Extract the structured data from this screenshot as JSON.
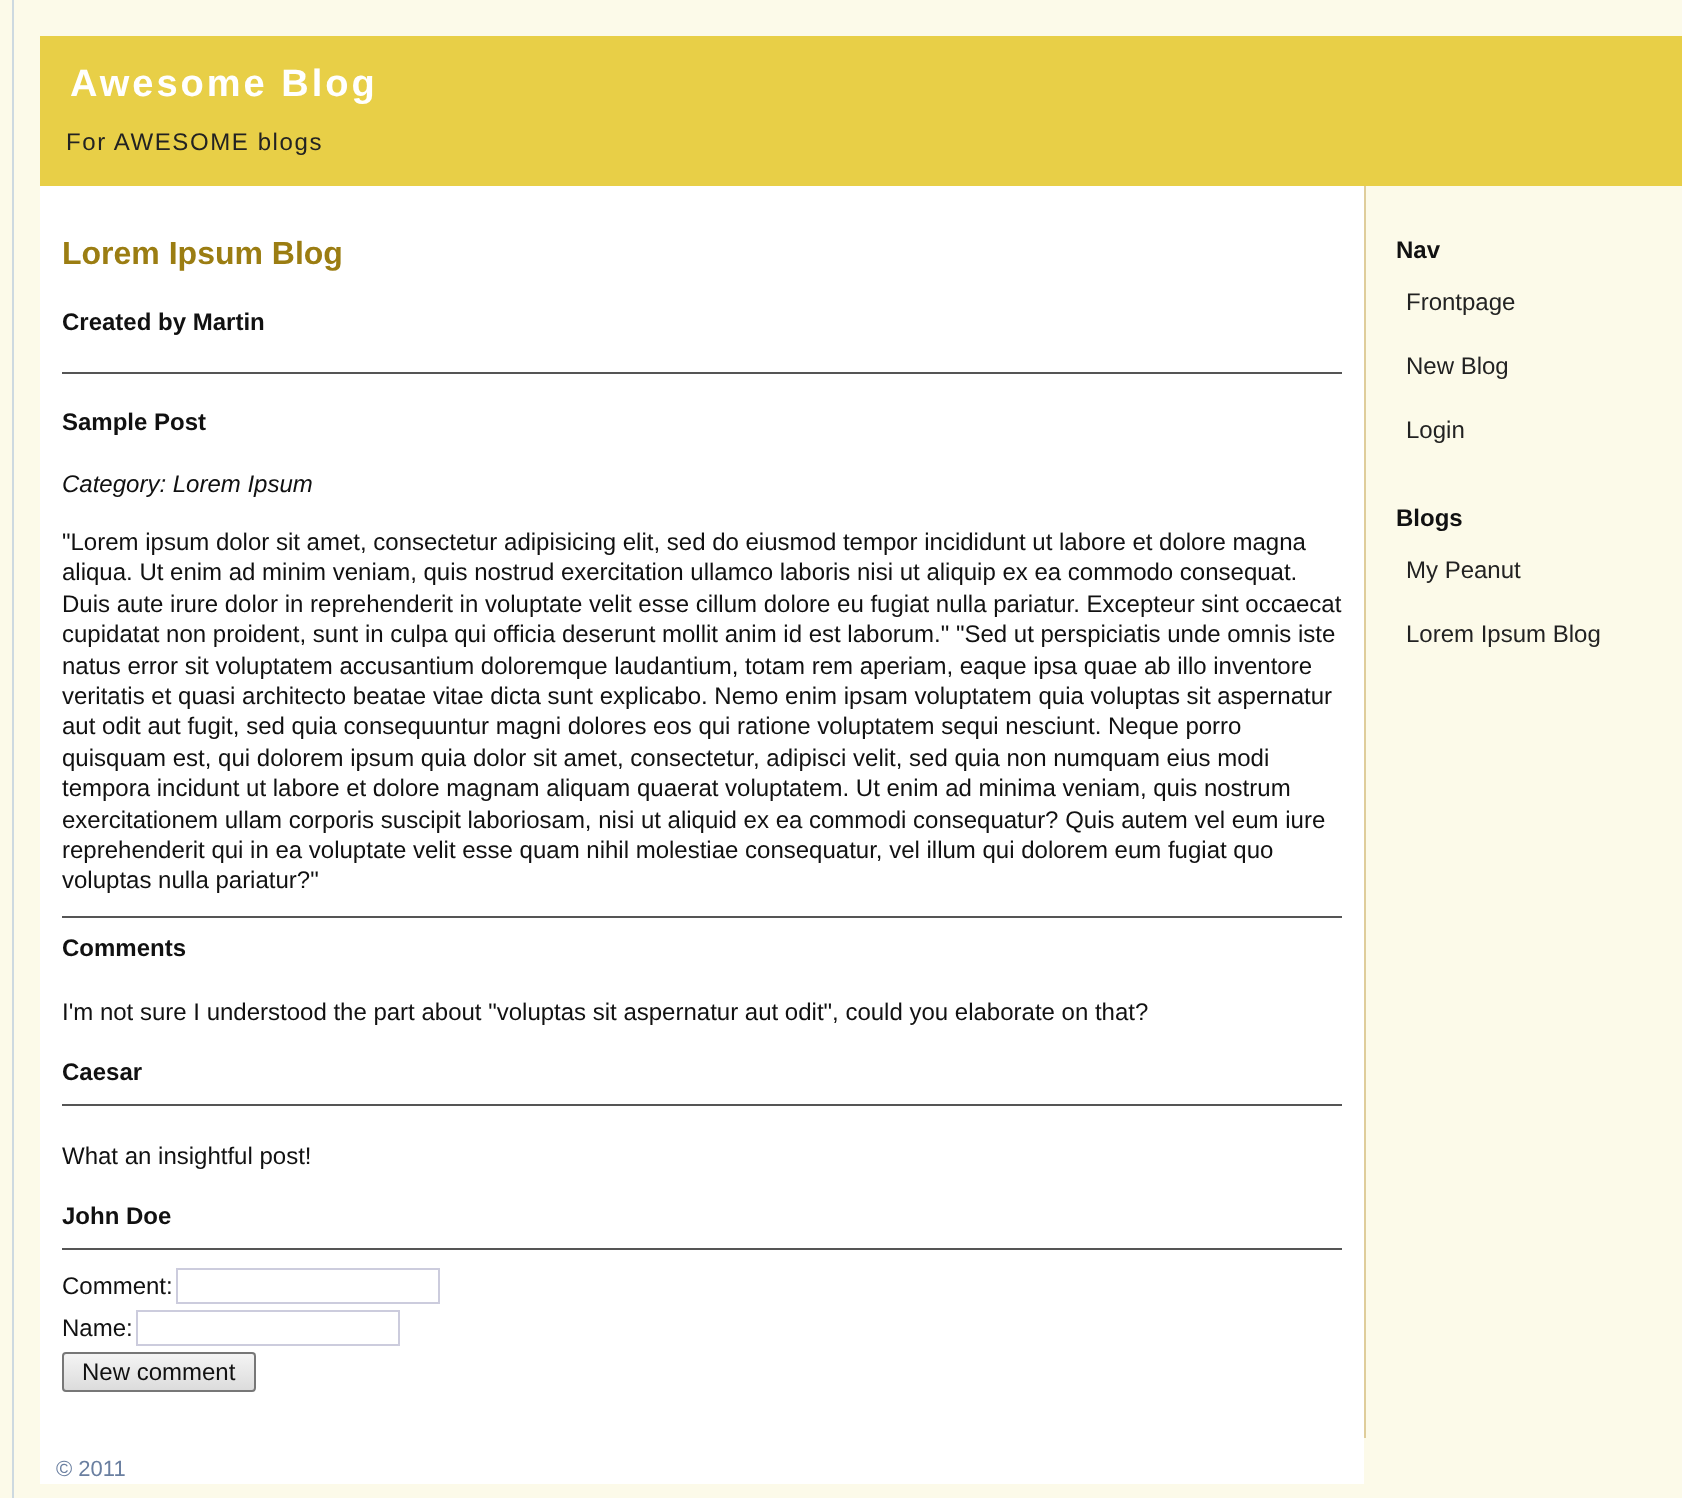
{
  "header": {
    "title": "Awesome Blog",
    "subtitle": "For AWESOME blogs"
  },
  "blog": {
    "title": "Lorem Ipsum Blog",
    "author_line": "Created by Martin"
  },
  "post": {
    "title": "Sample Post",
    "category": "Category: Lorem Ipsum",
    "body": "\"Lorem ipsum dolor sit amet, consectetur adipisicing elit, sed do eiusmod tempor incididunt ut labore et dolore magna aliqua. Ut enim ad minim veniam, quis nostrud exercitation ullamco laboris nisi ut aliquip ex ea commodo consequat. Duis aute irure dolor in reprehenderit in voluptate velit esse cillum dolore eu fugiat nulla pariatur. Excepteur sint occaecat cupidatat non proident, sunt in culpa qui officia deserunt mollit anim id est laborum.\" \"Sed ut perspiciatis unde omnis iste natus error sit voluptatem accusantium doloremque laudantium, totam rem aperiam, eaque ipsa quae ab illo inventore veritatis et quasi architecto beatae vitae dicta sunt explicabo. Nemo enim ipsam voluptatem quia voluptas sit aspernatur aut odit aut fugit, sed quia consequuntur magni dolores eos qui ratione voluptatem sequi nesciunt. Neque porro quisquam est, qui dolorem ipsum quia dolor sit amet, consectetur, adipisci velit, sed quia non numquam eius modi tempora incidunt ut labore et dolore magnam aliquam quaerat voluptatem. Ut enim ad minima veniam, quis nostrum exercitationem ullam corporis suscipit laboriosam, nisi ut aliquid ex ea commodi consequatur? Quis autem vel eum iure reprehenderit qui in ea voluptate velit esse quam nihil molestiae consequatur, vel illum qui dolorem eum fugiat quo voluptas nulla pariatur?\""
  },
  "comments": {
    "heading": "Comments",
    "items": [
      {
        "text": "I'm not sure I understood the part about \"voluptas sit aspernatur aut odit\", could you elaborate on that?",
        "author": "Caesar"
      },
      {
        "text": "What an insightful post!",
        "author": "John Doe"
      }
    ]
  },
  "form": {
    "fields": [
      {
        "label": "Comment:"
      },
      {
        "label": "Name:"
      }
    ],
    "submit": "New comment"
  },
  "footer": "© 2011",
  "sidebar": [
    {
      "heading": "Nav",
      "links": [
        "Frontpage",
        "New Blog",
        "Login"
      ]
    },
    {
      "heading": "Blogs",
      "links": [
        "My Peanut",
        "Lorem Ipsum Blog"
      ]
    }
  ]
}
